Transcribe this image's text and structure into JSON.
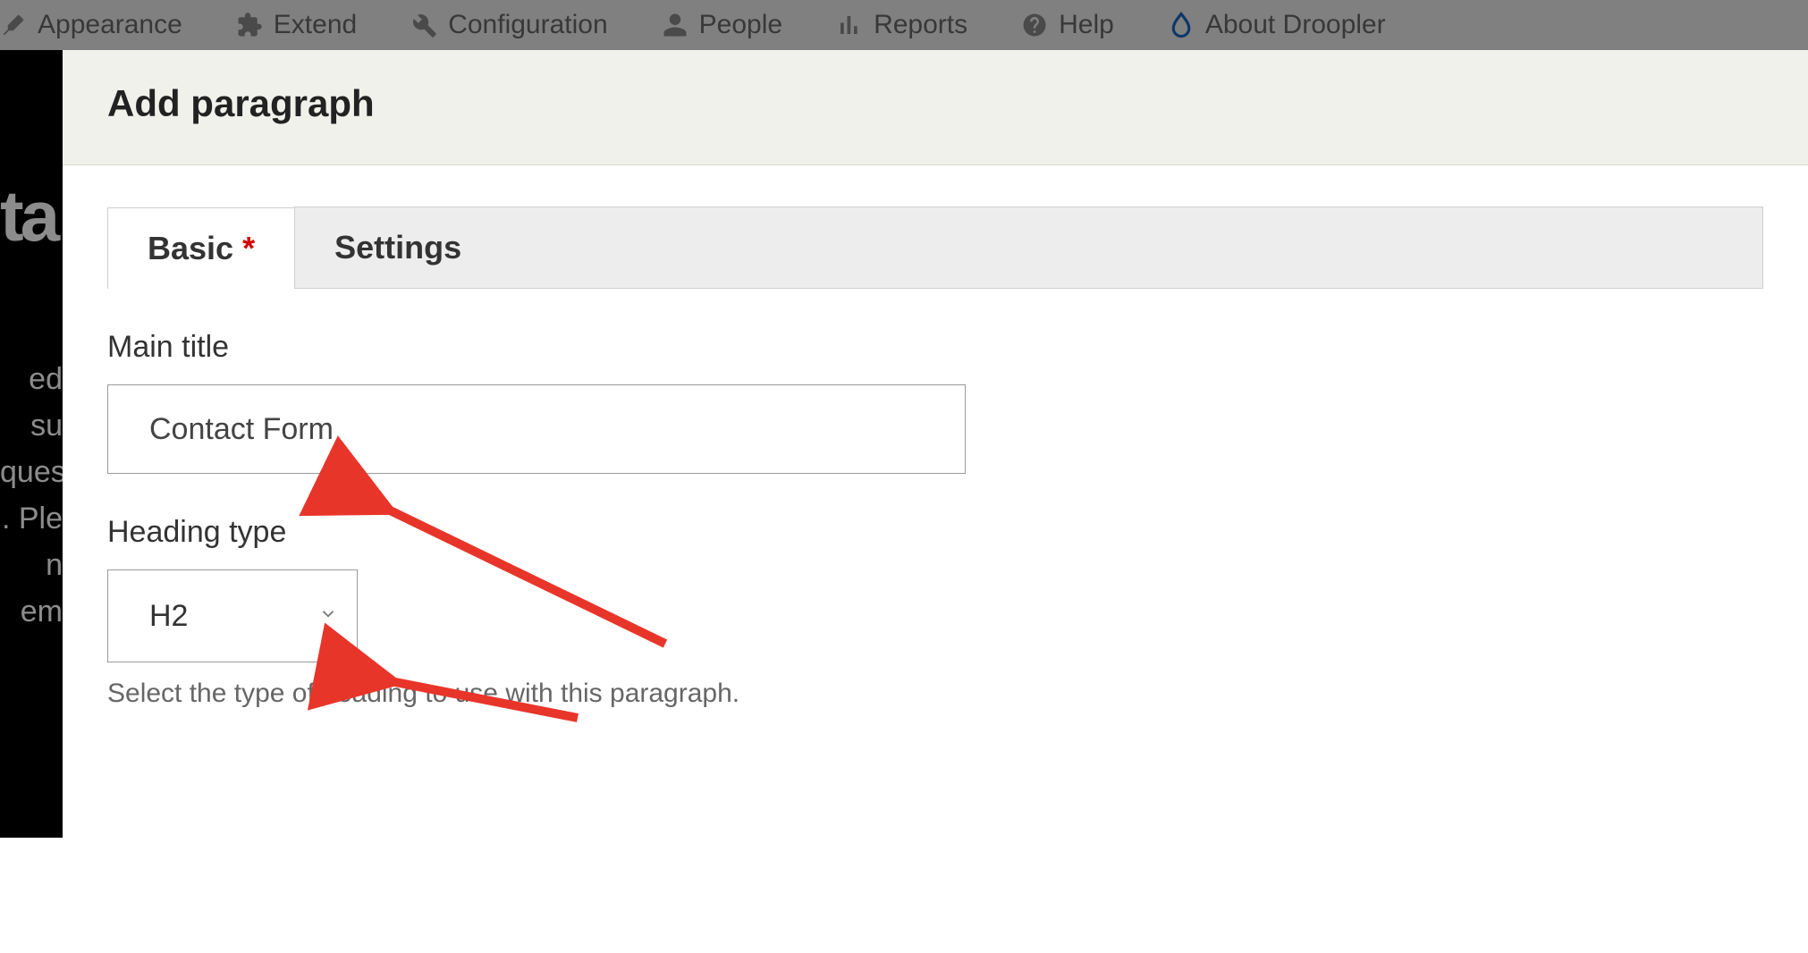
{
  "toolbar": {
    "items": [
      {
        "label": "Appearance"
      },
      {
        "label": "Extend"
      },
      {
        "label": "Configuration"
      },
      {
        "label": "People"
      },
      {
        "label": "Reports"
      },
      {
        "label": "Help"
      },
      {
        "label": "About Droopler"
      }
    ]
  },
  "backdrop_fragments": {
    "logo": "ta",
    "lines": [
      "ed su",
      "ques",
      ". Ple",
      "n em"
    ]
  },
  "modal": {
    "title": "Add paragraph",
    "tabs": [
      {
        "label": "Basic",
        "required": true,
        "active": true
      },
      {
        "label": "Settings",
        "required": false,
        "active": false
      }
    ],
    "main_title": {
      "label": "Main title",
      "value": "Contact Form"
    },
    "heading_type": {
      "label": "Heading type",
      "selected": "H2",
      "help": "Select the type of heading to use with this paragraph."
    }
  },
  "colors": {
    "required": "#d40000",
    "arrow": "#e8352a"
  },
  "required_marker": "*"
}
